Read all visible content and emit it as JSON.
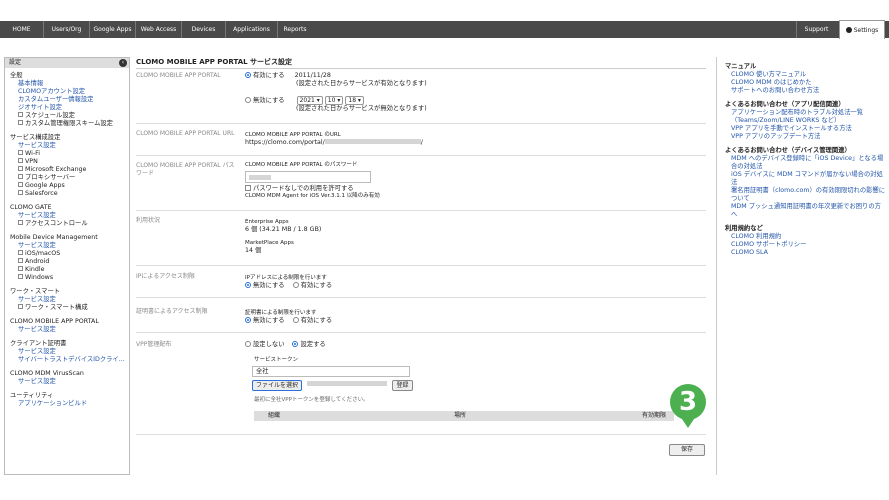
{
  "nav": {
    "items": [
      "HOME",
      "Users/Org",
      "Google Apps",
      "Web Access",
      "Devices",
      "Applications",
      "Reports"
    ],
    "support": "Support",
    "settings": "Settings"
  },
  "sidebar": {
    "header": "設定",
    "sections": [
      {
        "title": "全般",
        "links": [
          "基本情報",
          "CLOMOアカウント設定",
          "カスタムユーザー情報設定",
          "ジオサイト設定"
        ],
        "subs": [
          "スケジュール設定",
          "カスタム管理権限スキーム設定"
        ]
      },
      {
        "title": "サービス構成設定",
        "links": [
          "サービス設定"
        ],
        "subs": [
          "Wi-Fi",
          "VPN",
          "Microsoft Exchange",
          "プロキシサーバー",
          "Google Apps",
          "Salesforce"
        ]
      },
      {
        "title": "CLOMO GATE",
        "links": [
          "サービス設定"
        ],
        "subs": [
          "アクセスコントロール"
        ]
      },
      {
        "title": "Mobile Device Management",
        "links": [
          "サービス設定"
        ],
        "subs": [
          "iOS/macOS",
          "Android",
          "Kindle",
          "Windows"
        ]
      },
      {
        "title": "ワーク・スマート",
        "links": [
          "サービス設定"
        ],
        "subs": [
          "ワーク・スマート構成"
        ]
      },
      {
        "title": "CLOMO MOBILE APP PORTAL",
        "links": [
          "サービス設定"
        ],
        "subs": []
      },
      {
        "title": "クライアント証明書",
        "links": [
          "サービス設定",
          "サイバートラストデバイスIDクライ..."
        ],
        "subs": []
      },
      {
        "title": "CLOMO MDM VirusScan",
        "links": [
          "サービス設定"
        ],
        "subs": []
      },
      {
        "title": "ユーティリティ",
        "links": [
          "アプリケーションビルド"
        ],
        "subs": []
      }
    ]
  },
  "main": {
    "title": "CLOMO MOBILE APP PORTAL サービス設定",
    "portal": {
      "label": "CLOMO MOBILE APP PORTAL",
      "enable": "有効にする",
      "enable_date": "2011/11/28",
      "enable_note": "(設定された日からサービスが有効となります)",
      "disable": "無効にする",
      "year": "2021",
      "month": "10",
      "day": "18",
      "disable_note": "(設定された日からサービスが無効となります)"
    },
    "url": {
      "label": "CLOMO MOBILE APP PORTAL URL",
      "title": "CLOMO MOBILE APP PORTAL のURL",
      "prefix": "https://clomo.com/portal/",
      "suffix": "/"
    },
    "password": {
      "label": "CLOMO MOBILE APP PORTAL パスワード",
      "title": "CLOMO MOBILE APP PORTAL のパスワード",
      "allow_no_pw": "パスワードなしでの利用を許可する",
      "note": "CLOMO MDM Agent for iOS Ver.3.1.1 以降のみ有効"
    },
    "usage": {
      "label": "利用状況",
      "ent_title": "Enterprise Apps",
      "ent_value": "6 個 (34.21 MB / 1.8 GB)",
      "mp_title": "MarketPlace Apps",
      "mp_value": "14 個"
    },
    "ip": {
      "label": "IPによるアクセス制限",
      "title": "IPアドレスによる制限を行います",
      "off": "無効にする",
      "on": "有効にする"
    },
    "cert": {
      "label": "証明書によるアクセス制限",
      "title": "証明書による制限を行います",
      "off": "無効にする",
      "on": "有効にする"
    },
    "vpp": {
      "label": "VPP管理配布",
      "no": "設定しない",
      "yes": "設定する",
      "token_label": "サービストークン",
      "token_value": "全社",
      "choose_file": "ファイルを選択",
      "register": "登録",
      "register_note": "最初に全社VPPトークンを登録してください。",
      "col_org": "組織",
      "col_place": "場所",
      "col_expiry": "有効期限"
    },
    "save": "保存",
    "badge": "3"
  },
  "right": {
    "sections": [
      {
        "title": "マニュアル",
        "links": [
          "CLOMO 使い方マニュアル",
          "CLOMO MDM のはじめかた",
          "サポートへのお問い合わせ方法"
        ]
      },
      {
        "title": "よくあるお問い合わせ（アプリ配信関連）",
        "links": [
          "アプリケーション配布時のトラブル対処法一覧（Teams/Zoom/LINE WORKS など）",
          "VPP アプリを手動でインストールする方法",
          "VPP アプリのアップデート方法"
        ]
      },
      {
        "title": "よくあるお問い合わせ（デバイス管理関連）",
        "links": [
          "MDM へのデバイス登録時に「iOS Device」となる場合の対処法",
          "iOS デバイスに MDM コマンドが届かない場合の対処法",
          "署名用証明書（clomo.com）の有効期限切れの影響について",
          "MDM プッシュ通知用証明書の年次更新でお困りの方へ"
        ]
      },
      {
        "title": "利用規約など",
        "links": [
          "CLOMO 利用規約",
          "CLOMO サポートポリシー",
          "CLOMO SLA"
        ]
      }
    ]
  }
}
